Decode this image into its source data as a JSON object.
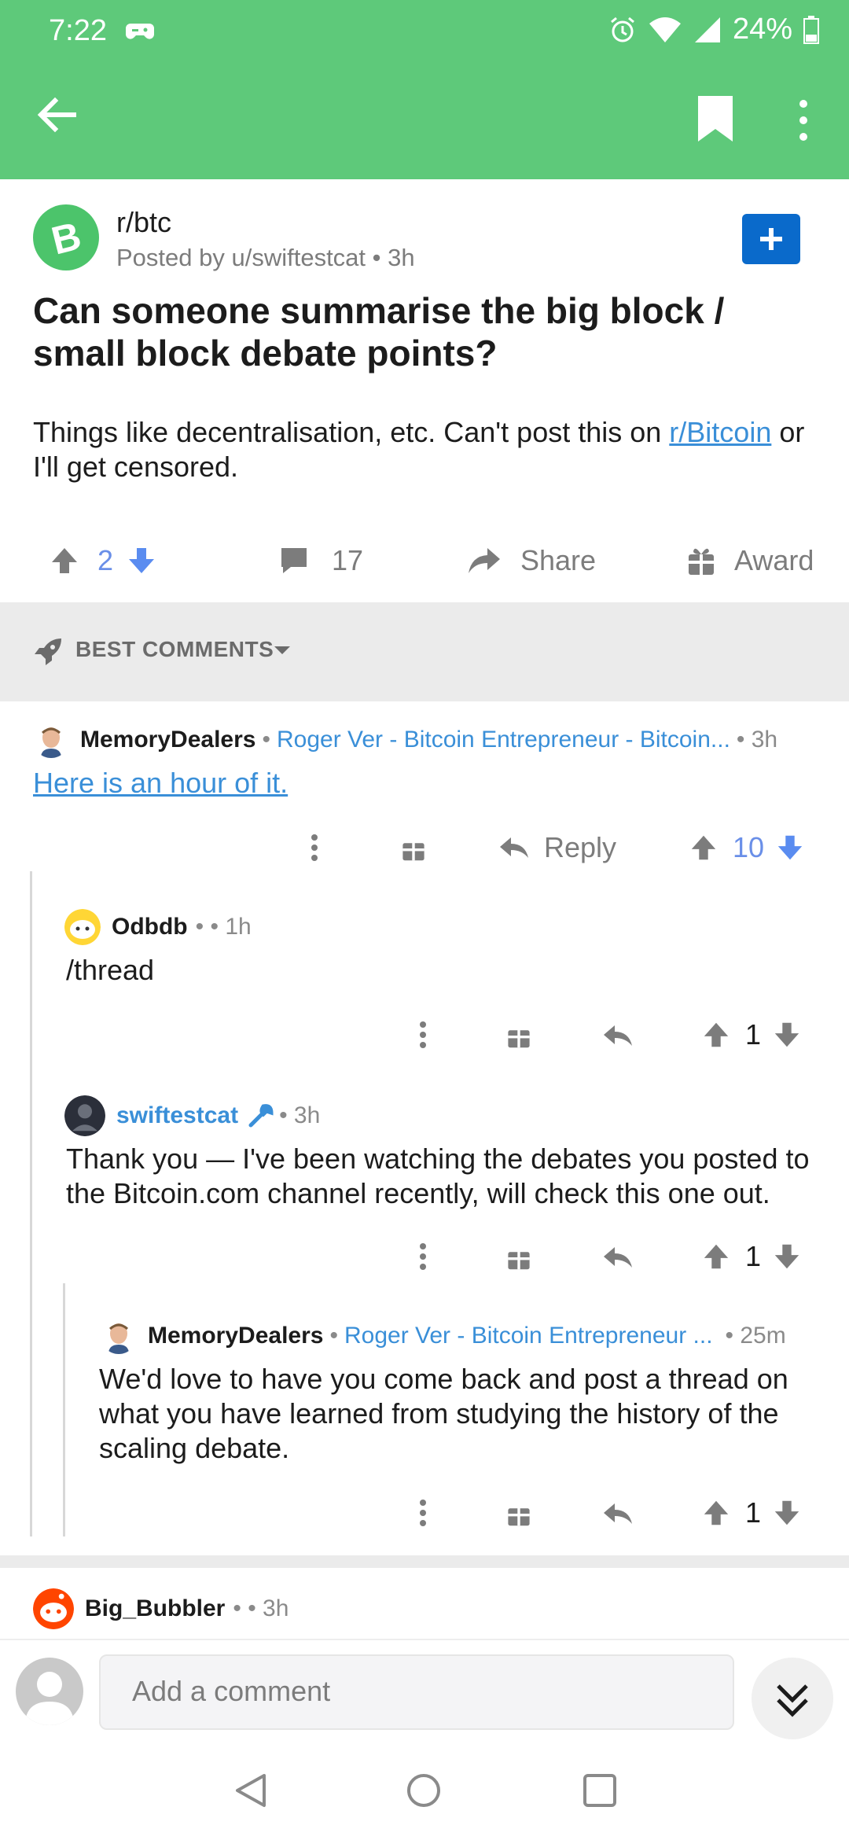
{
  "status_bar": {
    "time": "7:22",
    "battery": "24%"
  },
  "post": {
    "subreddit": "r/btc",
    "posted_by": "Posted by u/swiftestcat",
    "age": "3h",
    "title": "Can someone summarise the big block / small block debate points?",
    "body_prefix": "Things like decentralisation, etc. Can't post this on ",
    "body_link": "r/Bitcoin",
    "body_suffix": " or I'll get censored.",
    "score": "2",
    "comment_count": "17",
    "share_label": "Share",
    "award_label": "Award"
  },
  "sort": {
    "label": "BEST COMMENTS"
  },
  "comments": [
    {
      "author": "MemoryDealers",
      "flair": "Roger Ver - Bitcoin Entrepreneur - Bitcoin...",
      "age": "• 3h",
      "body_link": "Here is an hour of it.",
      "reply_label": "Reply",
      "score": "10"
    },
    {
      "author": "Odbdb",
      "age": "• • 1h",
      "body": "/thread",
      "score": "1"
    },
    {
      "author": "swiftestcat",
      "age": "• 3h",
      "body": "Thank you — I've been watching the debates you posted to the Bitcoin.com channel recently, will check this one out.",
      "score": "1"
    },
    {
      "author": "MemoryDealers",
      "flair": "Roger Ver - Bitcoin Entrepreneur ...",
      "age": "• 25m",
      "body": "We'd love to have you come back and post a thread on what you have learned from studying the history of the scaling debate.",
      "score": "1"
    },
    {
      "author": "Big_Bubbler",
      "age": "• • 3h"
    }
  ],
  "composer": {
    "placeholder": "Add a comment"
  },
  "colors": {
    "app_bar": "#5ec97a",
    "link": "#3a8fd8",
    "upvote_active": "#6a8fe8",
    "join_button": "#0a6acb"
  }
}
